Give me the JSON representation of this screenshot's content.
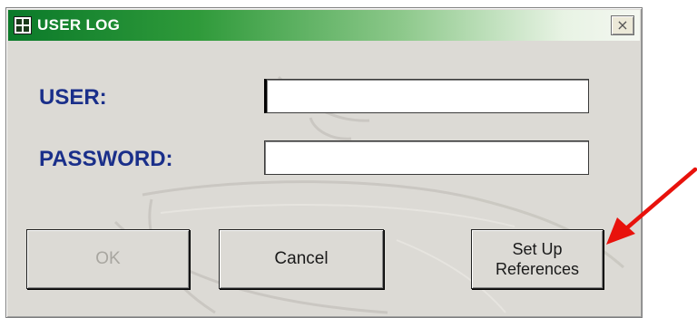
{
  "window": {
    "title": "USER LOG",
    "close_glyph": "×",
    "icon": "form-icon"
  },
  "form": {
    "user_label": "USER:",
    "user_value": "",
    "password_label": "PASSWORD:",
    "password_value": ""
  },
  "buttons": {
    "ok_label": "OK",
    "cancel_label": "Cancel",
    "setup_line1": "Set Up",
    "setup_line2": "References"
  },
  "annotation": {
    "arrow_color": "#e8120c",
    "icon": "red-arrow-icon"
  },
  "colors": {
    "title_gradient_start": "#0b7a2a",
    "label_color": "#1a2f8a",
    "dialog_bg": "#dcdad5"
  }
}
